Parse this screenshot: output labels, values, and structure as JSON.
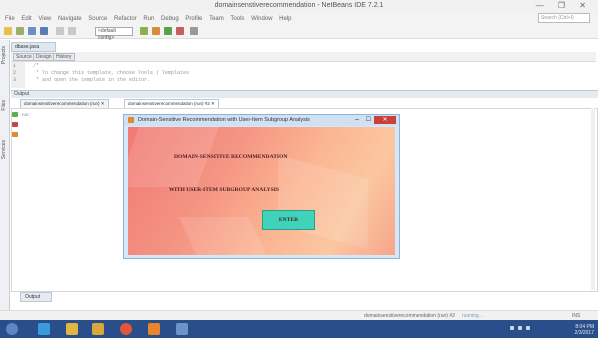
{
  "window": {
    "title": "domainsenstiverecommendation - NetBeans IDE 7.2.1",
    "controls": "— ❐ ✕",
    "search_placeholder": "Search (Ctrl+I)"
  },
  "menu": [
    "File",
    "Edit",
    "View",
    "Navigate",
    "Source",
    "Refactor",
    "Run",
    "Debug",
    "Profile",
    "Team",
    "Tools",
    "Window",
    "Help"
  ],
  "toolbar": {
    "config_value": "<default config>"
  },
  "left_panel": {
    "labels": [
      "Projects",
      "Files",
      "Services"
    ]
  },
  "editor": {
    "tab_label": "dbase.java",
    "subtabs": [
      "Source",
      "Design",
      "History"
    ],
    "lines": [
      {
        "n": "1",
        "text": "/*"
      },
      {
        "n": "2",
        "text": " * To change this template, choose Tools | Templates"
      },
      {
        "n": "3",
        "text": " * and open the template in the editor."
      }
    ]
  },
  "output": {
    "header": "Output",
    "tabs": [
      "domainsenstiverecommendation (run) ✕",
      "domainsenstiverecommendation (run) #2 ✕"
    ],
    "run_text": "run:"
  },
  "dialog": {
    "title": "Domain-Sensitive Recommendation with User-Item Subgroup Analysis",
    "heading_line1": "DOMAIN-SENSITIVE RECOMMENDATION",
    "heading_line2": "WITH USER-ITEM SUBGROUP ANALYSIS",
    "button_label": "ENTER"
  },
  "bottom_tab": "Output",
  "status": {
    "running": "domainsenstiverecommendation (run) #2",
    "progress_label": "running...",
    "insert_mode": "INS"
  },
  "taskbar": {
    "clock_time": "8:04 PM",
    "clock_date": "2/3/2017"
  }
}
